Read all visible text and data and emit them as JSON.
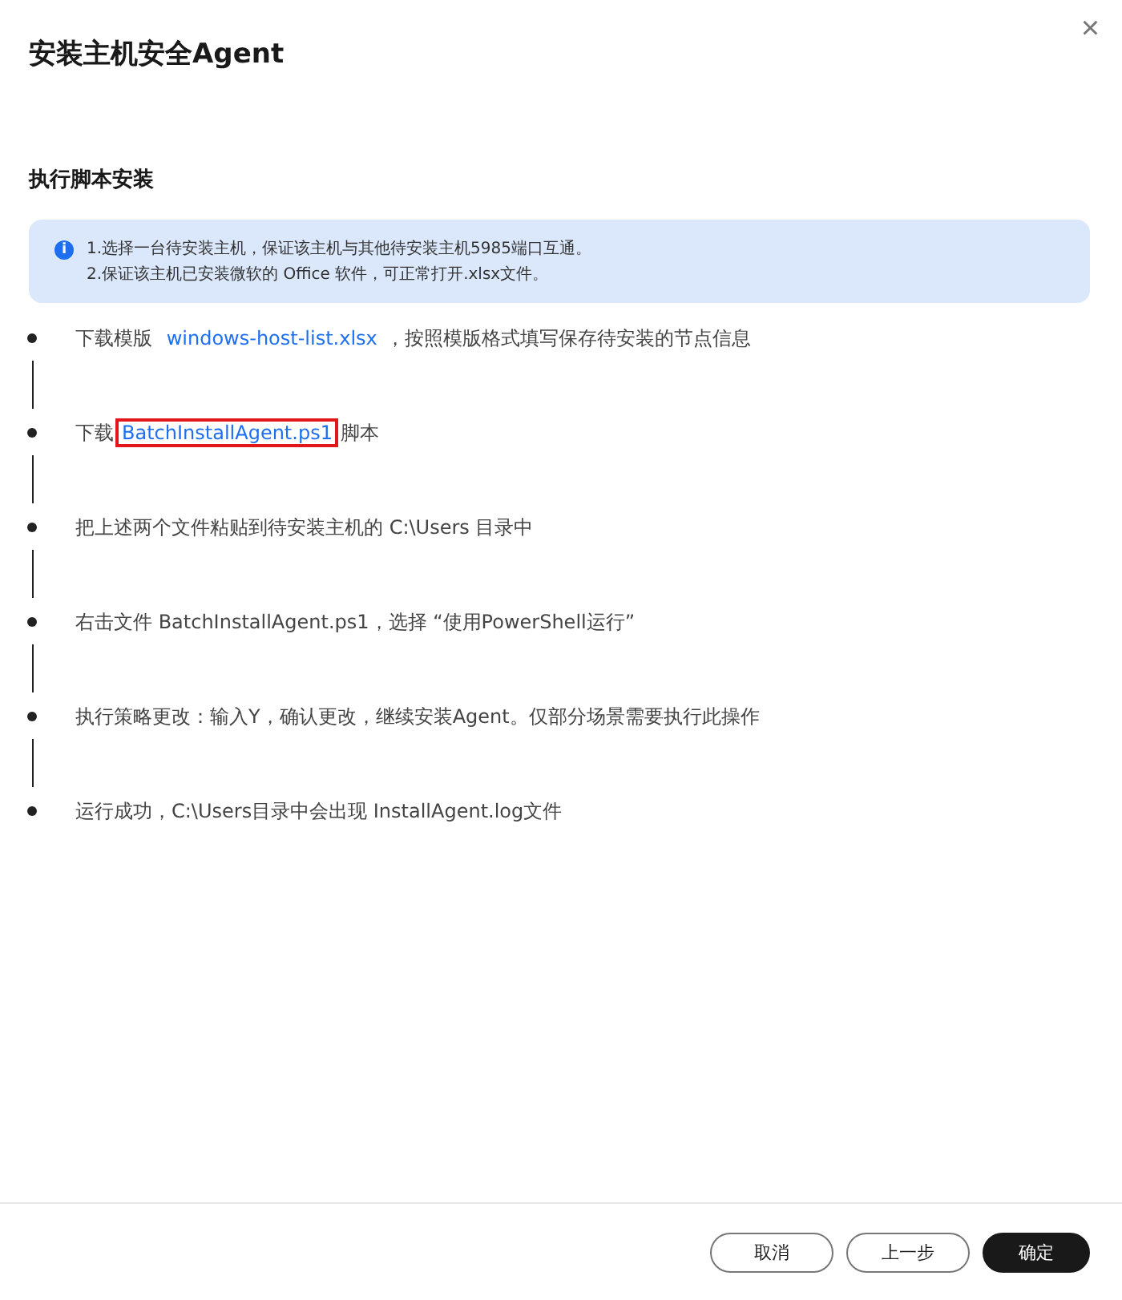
{
  "dialog": {
    "title": "安装主机安全Agent",
    "close": "×"
  },
  "section": {
    "title": "执行脚本安装"
  },
  "notice": {
    "icon": "i",
    "lines": [
      "1.选择一台待安装主机，保证该主机与其他待安装主机5985端口互通。",
      "2.保证该主机已安装微软的 Office 软件，可正常打开.xlsx文件。"
    ]
  },
  "steps": [
    {
      "parts": [
        {
          "kind": "text",
          "text": "下载模版 "
        },
        {
          "kind": "link",
          "text": "windows-host-list.xlsx",
          "highlighted": false
        },
        {
          "kind": "text",
          "text": "，按照模版格式填写保存待安装的节点信息"
        }
      ]
    },
    {
      "parts": [
        {
          "kind": "text",
          "text": "下载"
        },
        {
          "kind": "link",
          "text": "BatchInstallAgent.ps1",
          "highlighted": true
        },
        {
          "kind": "text",
          "text": "脚本"
        }
      ]
    },
    {
      "parts": [
        {
          "kind": "text",
          "text": "把上述两个文件粘贴到待安装主机的 C:\\Users 目录中"
        }
      ]
    },
    {
      "parts": [
        {
          "kind": "text",
          "text": "右击文件 BatchInstallAgent.ps1，选择 “使用PowerShell运行”"
        }
      ]
    },
    {
      "parts": [
        {
          "kind": "text",
          "text": "执行策略更改：输入Y，确认更改，继续安装Agent。仅部分场景需要执行此操作"
        }
      ]
    },
    {
      "parts": [
        {
          "kind": "text",
          "text": "运行成功，C:\\Users目录中会出现 InstallAgent.log文件"
        }
      ]
    }
  ],
  "buttons": [
    {
      "label": "取消",
      "kind": "secondary"
    },
    {
      "label": "上一步",
      "kind": "secondary"
    },
    {
      "label": "确定",
      "kind": "primary"
    }
  ]
}
